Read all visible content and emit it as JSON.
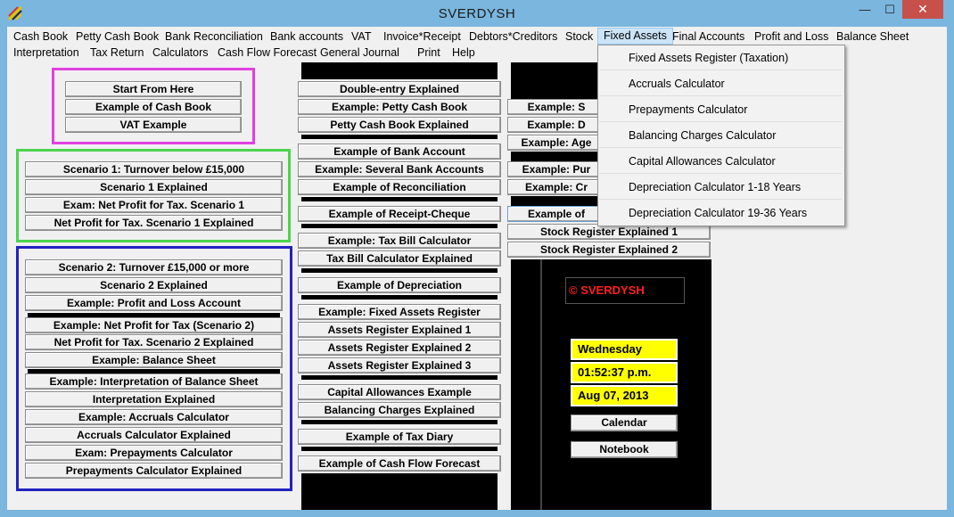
{
  "window": {
    "title": "SVERDYSH",
    "close_glyph": "✕",
    "min_glyph": "—",
    "max_glyph": "☐"
  },
  "menu": [
    "Cash Book",
    "Petty Cash Book",
    "Bank Reconciliation",
    "Bank accounts",
    "VAT",
    "Invoice*Receipt",
    "Debtors*Creditors",
    "Stock",
    "Fixed Assets",
    "Final Accounts",
    "Profit and Loss",
    "Balance Sheet",
    "Interpretation",
    "Tax Return",
    "Calculators",
    "Cash Flow Forecast",
    "General Journal",
    "Print",
    "Help"
  ],
  "dropdown": [
    "Fixed Assets Register (Taxation)",
    "Accruals Calculator",
    "Prepayments Calculator",
    "Balancing Charges Calculator",
    "Capital Allowances Calculator",
    "Depreciation Calculator 1-18 Years",
    "Depreciation Calculator 19-36 Years"
  ],
  "col1": {
    "magenta": [
      "Start From Here",
      "Example of Cash Book",
      "VAT Example"
    ],
    "green": [
      "Scenario 1: Turnover below £15,000",
      "Scenario 1 Explained",
      "Exam: Net Profit for Tax. Scenario 1",
      "Net Profit for Tax. Scenario 1 Explained"
    ],
    "blue": [
      "Scenario 2: Turnover £15,000 or more",
      "Scenario 2 Explained",
      "Example: Profit and Loss Account",
      "Example: Net Profit for Tax (Scenario 2)",
      "Net Profit for Tax. Scenario 2 Explained",
      "Example: Balance Sheet",
      "Example: Interpretation of Balance Sheet",
      "Interpretation Explained",
      "Example: Accruals Calculator",
      "Accruals Calculator Explained",
      "Exam: Prepayments Calculator",
      "Prepayments Calculator Explained"
    ]
  },
  "col2": [
    "Double-entry Explained",
    "Example: Petty Cash Book",
    "Petty Cash Book Explained",
    "Example of Bank Account",
    "Example: Several Bank Accounts",
    "Example of Reconciliation",
    "Example of Receipt-Cheque",
    "Example: Tax Bill Calculator",
    "Tax Bill Calculator Explained",
    "Example of Depreciation",
    "Example: Fixed Assets Register",
    "Assets Register Explained 1",
    "Assets Register Explained 2",
    "Assets Register Explained 3",
    "Capital Allowances Example",
    "Balancing Charges Explained",
    "Example of Tax Diary",
    "Example of Cash Flow Forecast"
  ],
  "col3": [
    "Example: S",
    "Example: D",
    "Example: Age",
    "Example: Pur",
    "Example: Cr",
    "Example of",
    "Stock Register Explained 1",
    "Stock Register Explained 2"
  ],
  "panel": {
    "brand": "© SVERDYSH",
    "day": "Wednesday",
    "time": "01:52:37 p.m.",
    "date": "Aug 07, 2013",
    "calendar": "Calendar",
    "notebook": "Notebook"
  }
}
